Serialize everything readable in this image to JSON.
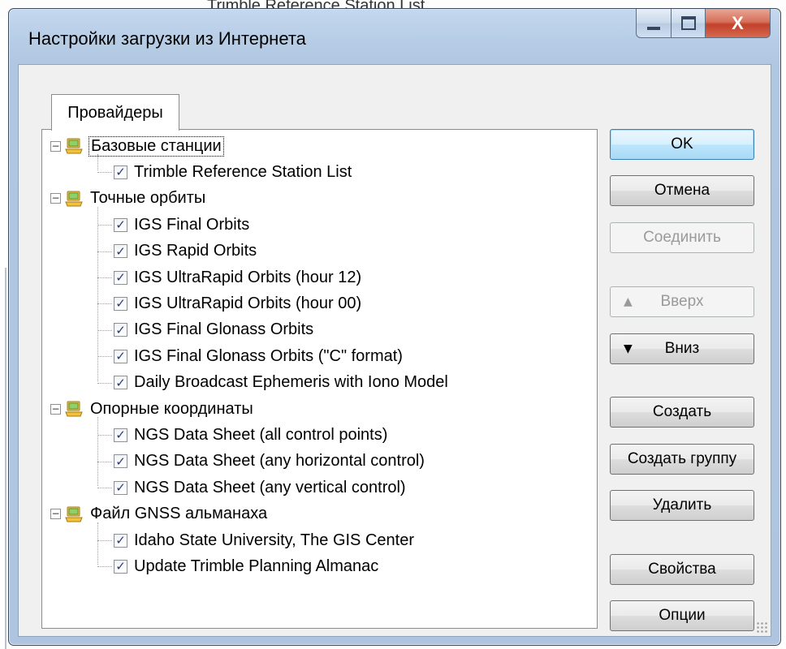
{
  "background": {
    "window_title_fragment": "Trimble Reference Station List"
  },
  "window": {
    "title": "Настройки загрузки из Интернета",
    "close_glyph": "X"
  },
  "tabs": [
    {
      "label": "Провайдеры",
      "selected": true
    }
  ],
  "tree": {
    "groups": [
      {
        "label": "Базовые станции",
        "expanded": true,
        "items": [
          {
            "label": "Trimble Reference Station List",
            "checked": true
          }
        ]
      },
      {
        "label": "Точные орбиты",
        "expanded": true,
        "items": [
          {
            "label": "IGS Final Orbits",
            "checked": true
          },
          {
            "label": "IGS Rapid Orbits",
            "checked": true
          },
          {
            "label": "IGS UltraRapid Orbits (hour 12)",
            "checked": true
          },
          {
            "label": "IGS UltraRapid Orbits (hour 00)",
            "checked": true
          },
          {
            "label": "IGS Final Glonass Orbits",
            "checked": true
          },
          {
            "label": "IGS Final Glonass Orbits (\"C\" format)",
            "checked": true
          },
          {
            "label": "Daily Broadcast Ephemeris with Iono Model",
            "checked": true
          }
        ]
      },
      {
        "label": "Опорные координаты",
        "expanded": true,
        "items": [
          {
            "label": "NGS Data Sheet (all control points)",
            "checked": true
          },
          {
            "label": "NGS Data Sheet (any horizontal control)",
            "checked": true
          },
          {
            "label": "NGS Data Sheet (any vertical control)",
            "checked": true
          }
        ]
      },
      {
        "label": "Файл GNSS альманаха",
        "expanded": true,
        "items": [
          {
            "label": "Idaho State University, The GIS Center",
            "checked": true
          },
          {
            "label": "Update Trimble Planning Almanac",
            "checked": true
          }
        ]
      }
    ]
  },
  "buttons": {
    "ok": "OK",
    "cancel": "Отмена",
    "connect": "Соединить",
    "up": "Вверх",
    "down": "Вниз",
    "create": "Создать",
    "create_group": "Создать группу",
    "delete": "Удалить",
    "properties": "Свойства",
    "options": "Опции"
  },
  "colors": {
    "title_bar": "#b7cde6",
    "close_button": "#c2412a",
    "default_button_border": "#3c7fb1"
  }
}
